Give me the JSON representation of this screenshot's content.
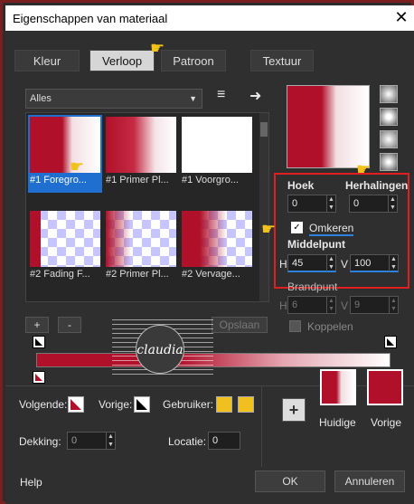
{
  "window": {
    "title": "Eigenschappen van materiaal",
    "close_glyph": "✕"
  },
  "tabs": [
    {
      "label": "Kleur",
      "active": false
    },
    {
      "label": "Verloop",
      "active": true
    },
    {
      "label": "Patroon",
      "active": false
    },
    {
      "label": "Textuur",
      "active": false
    }
  ],
  "category": {
    "value": "Alles"
  },
  "gradients": [
    {
      "label": "#1 Foregro...",
      "selected": true
    },
    {
      "label": "#1 Primer Pl...",
      "selected": false
    },
    {
      "label": "#1 Voorgro...",
      "selected": false
    },
    {
      "label": "#2 Fading F...",
      "selected": false
    },
    {
      "label": "#2 Primer Pl...",
      "selected": false
    },
    {
      "label": "#2 Vervage...",
      "selected": false
    }
  ],
  "controls": {
    "add": "+",
    "remove": "-",
    "save": "Opslaan",
    "hoek_label": "Hoek",
    "hoek_value": "0",
    "herhalingen_label": "Herhalingen",
    "herhalingen_value": "0",
    "omkeren_label": "Omkeren",
    "omkeren_checked": true,
    "middelpunt_label": "Middelpunt",
    "h_label": "H",
    "h_value": "45",
    "v_label": "V",
    "v_value": "100",
    "brandpunt_label": "Brandpunt",
    "bh_value": "6",
    "bv_value": "9",
    "koppelen_label": "Koppelen"
  },
  "bottom": {
    "volgende_label": "Volgende:",
    "vorige_label": "Vorige:",
    "gebruiker_label": "Gebruiker:",
    "dekking_label": "Dekking:",
    "dekking_value": "0",
    "locatie_label": "Locatie:",
    "locatie_value": "0",
    "huidige_label": "Huidige",
    "vorige_swatch_label": "Vorige",
    "plus_glyph": "+"
  },
  "footer": {
    "help": "Help",
    "ok": "OK",
    "cancel": "Annuleren"
  },
  "watermark": {
    "text": "claudia"
  },
  "colors": {
    "primary_red": "#b0102a",
    "highlight_frame": "#e02020",
    "accent_blue": "#1e6fd0",
    "pointer_hand": "#f2c21b",
    "user_yellow": "#f0c020"
  },
  "icons": {
    "hand": "☛",
    "arrow_right": "➜",
    "menu": "≡"
  }
}
